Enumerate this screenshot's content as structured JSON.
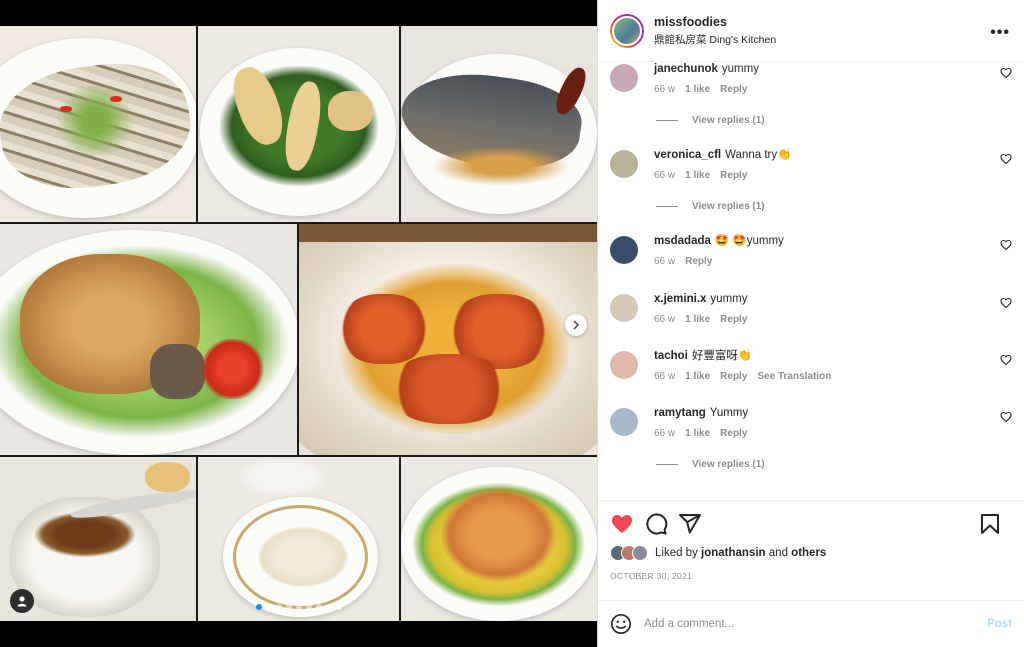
{
  "post": {
    "username": "missfoodies",
    "location": "鼎館私房菜 Ding's Kitchen",
    "more_icon": "more-horizontal-icon"
  },
  "carousel": {
    "total_slides": 9,
    "active_slide": 1
  },
  "comments": [
    {
      "user": "janechunok",
      "text": "yummy",
      "time": "66 w",
      "likes": "1 like",
      "reply": "Reply",
      "translate": "",
      "view_replies": "View replies (1)",
      "avatar_color": "#c9a6b8"
    },
    {
      "user": "veronica_cfl",
      "text": "Wanna try👏",
      "time": "66 w",
      "likes": "1 like",
      "reply": "Reply",
      "translate": "",
      "view_replies": "View replies (1)",
      "avatar_color": "#b9b39a"
    },
    {
      "user": "msdadada",
      "text": "🤩 🤩yummy",
      "time": "66 w",
      "likes": "",
      "reply": "Reply",
      "translate": "",
      "view_replies": "",
      "avatar_color": "#3a4a6a"
    },
    {
      "user": "x.jemini.x",
      "text": "yummy",
      "time": "66 w",
      "likes": "1 like",
      "reply": "Reply",
      "translate": "",
      "view_replies": "",
      "avatar_color": "#d7c7b5"
    },
    {
      "user": "tachoi",
      "text": "好豐富呀👏",
      "time": "66 w",
      "likes": "1 like",
      "reply": "Reply",
      "translate": "See Translation",
      "view_replies": "",
      "avatar_color": "#e0b8a8"
    },
    {
      "user": "ramytang",
      "text": "Yummy",
      "time": "66 w",
      "likes": "1 like",
      "reply": "Reply",
      "translate": "",
      "view_replies": "View replies (1)",
      "avatar_color": "#a9b9c9"
    }
  ],
  "actions": {
    "like_color": "#ed4956",
    "liked_by_prefix": "Liked by",
    "liked_by_user": "jonathansin",
    "liked_by_and": "and",
    "liked_by_others": "others",
    "date": "OCTOBER 30, 2021"
  },
  "comment_box": {
    "placeholder": "Add a comment...",
    "post_label": "Post"
  }
}
